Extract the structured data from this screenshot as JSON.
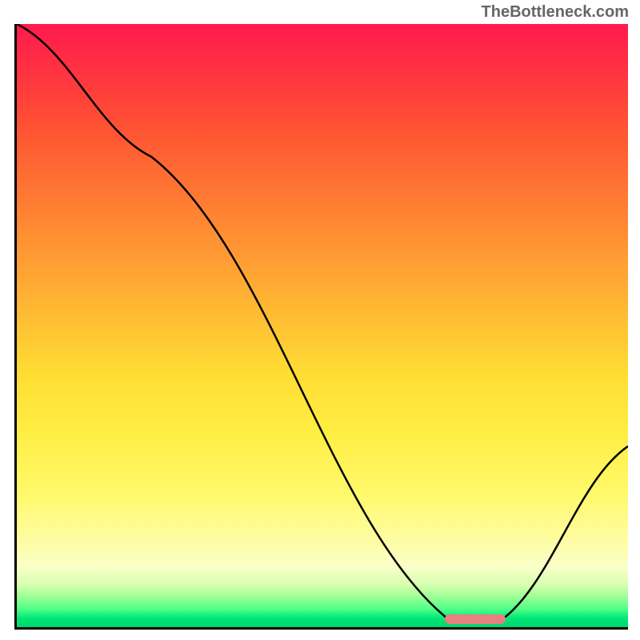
{
  "watermark": "TheBottleneck.com",
  "chart_data": {
    "type": "line",
    "title": "",
    "xlabel": "",
    "ylabel": "",
    "xlim": [
      0,
      100
    ],
    "ylim": [
      0,
      100
    ],
    "x": [
      0,
      22,
      71,
      79,
      100
    ],
    "values": [
      100,
      78,
      1,
      1,
      30
    ],
    "background_gradient": {
      "top": "#ff1a4d",
      "mid": "#ffee44",
      "bottom": "#00d46a"
    },
    "optimum_marker": {
      "x_start": 70,
      "x_end": 80,
      "color": "#e88080"
    }
  }
}
